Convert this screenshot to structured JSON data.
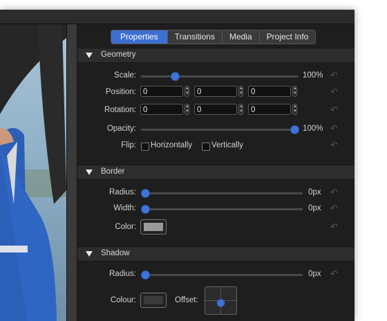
{
  "tabs": [
    {
      "label": "Properties",
      "active": true
    },
    {
      "label": "Transitions",
      "active": false
    },
    {
      "label": "Media",
      "active": false
    },
    {
      "label": "Project Info",
      "active": false
    }
  ],
  "geometry": {
    "title": "Geometry",
    "scale": {
      "label": "Scale:",
      "value": "100%",
      "slider_fraction": 0.2
    },
    "position": {
      "label": "Position:",
      "fields": [
        "0",
        "0",
        "0"
      ]
    },
    "rotation": {
      "label": "Rotation:",
      "fields": [
        "0",
        "0",
        "0"
      ]
    },
    "opacity": {
      "label": "Opacity:",
      "value": "100%",
      "slider_fraction": 1.0
    },
    "flip": {
      "label": "Flip:",
      "horizontal": "Horizontally",
      "vertical": "Vertically"
    }
  },
  "border": {
    "title": "Border",
    "radius": {
      "label": "Radius:",
      "value": "0px",
      "slider_fraction": 0.0
    },
    "width": {
      "label": "Width:",
      "value": "0px",
      "slider_fraction": 0.0
    },
    "color": {
      "label": "Color:",
      "swatch": "#9a9a9a"
    }
  },
  "shadow": {
    "title": "Shadow",
    "radius": {
      "label": "Radius:",
      "value": "0px",
      "slider_fraction": 0.0
    },
    "colour": {
      "label": "Colour:",
      "swatch": "#3a3a3a"
    },
    "offset": {
      "label": "Offset:"
    }
  },
  "colors": {
    "accent": "#3d6fd3",
    "panel": "#1e1e1e",
    "section": "#2d2d2d"
  },
  "icons": {
    "reset": "reset-arrow-icon",
    "disclosure": "disclosure-triangle-icon"
  }
}
